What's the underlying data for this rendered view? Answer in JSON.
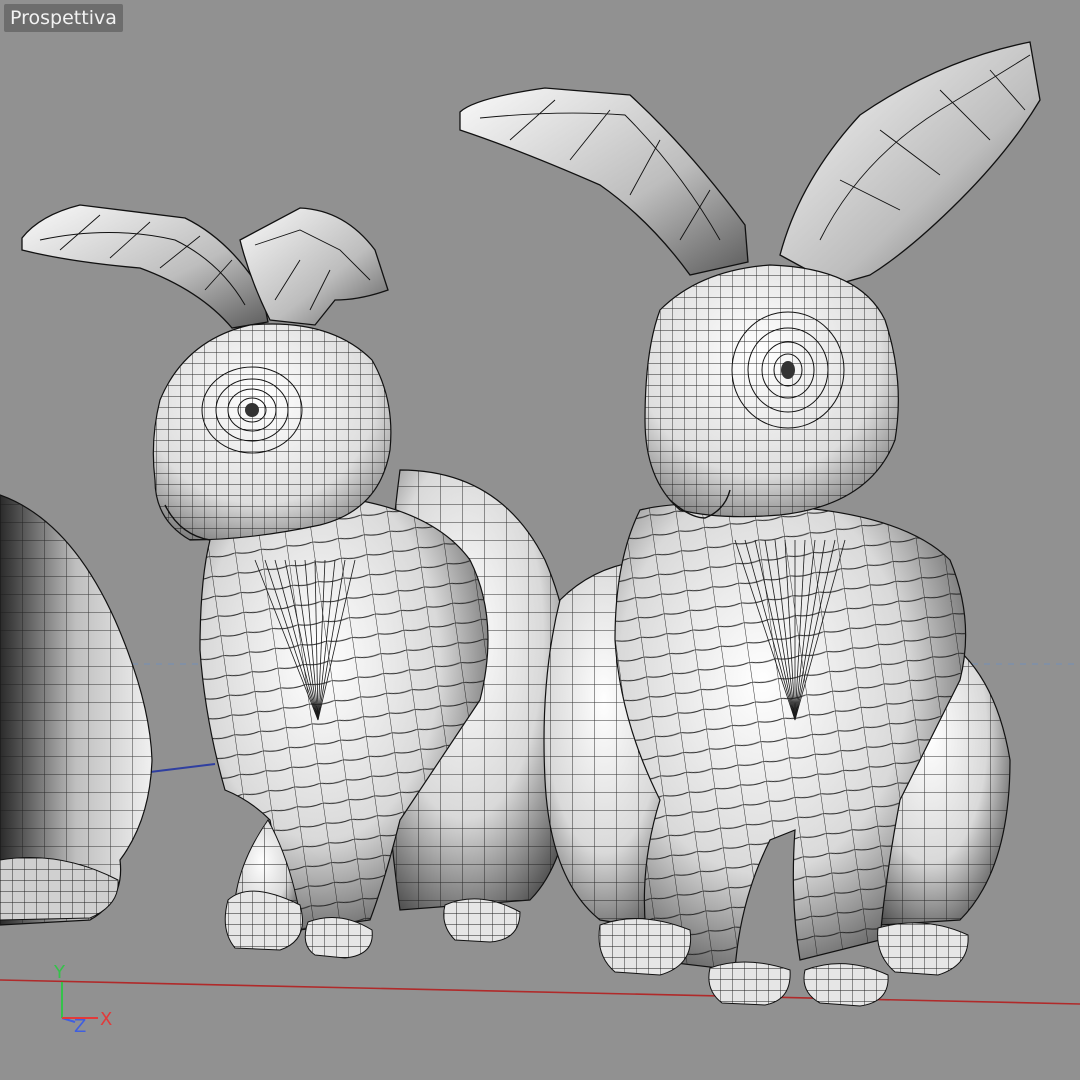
{
  "viewport": {
    "label": "Prospettiva",
    "colors": {
      "background": "#919191",
      "grid_axis_x": "#b02a2a",
      "grid_axis_z": "#2f3fa0",
      "horizon": "#7a8fb0",
      "axis_y": "#35c24a",
      "axis_z": "#3f5fe0",
      "axis_x": "#e23a3a"
    }
  },
  "axis_gizmo": {
    "y_label": "Y",
    "z_label": "Z",
    "x_label": "X"
  },
  "scene": {
    "objects": [
      {
        "name": "rabbit-left-partial"
      },
      {
        "name": "rabbit-middle"
      },
      {
        "name": "rabbit-right"
      }
    ],
    "display_mode": "shaded-wireframe"
  }
}
